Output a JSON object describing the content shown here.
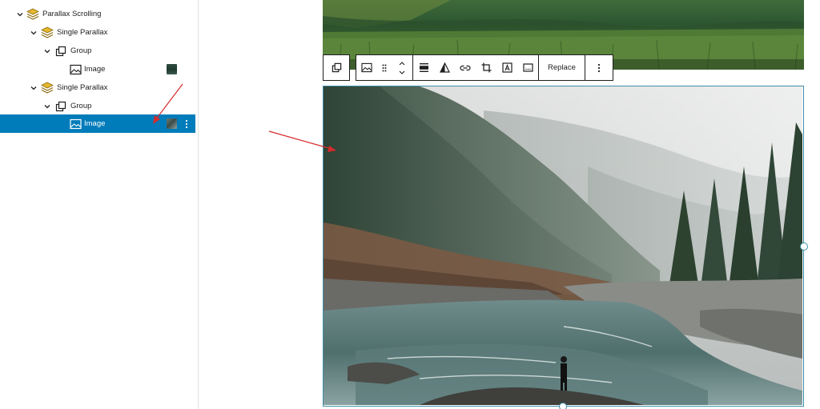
{
  "list_view": {
    "items": [
      {
        "label": "Parallax Scrolling",
        "icon": "parallax-block-icon",
        "chevron": "chevron-down-icon"
      },
      {
        "label": "Single Parallax",
        "icon": "parallax-block-icon",
        "chevron": "chevron-down-icon"
      },
      {
        "label": "Group",
        "icon": "group-icon",
        "chevron": "chevron-down-icon"
      },
      {
        "label": "Image",
        "icon": "image-icon",
        "thumbnail": "dark-forest"
      },
      {
        "label": "Single Parallax",
        "icon": "parallax-block-icon",
        "chevron": "chevron-down-icon"
      },
      {
        "label": "Group",
        "icon": "group-icon",
        "chevron": "chevron-down-icon"
      },
      {
        "label": "Image",
        "icon": "image-icon",
        "thumbnail": "river",
        "selected": true
      }
    ]
  },
  "toolbar": {
    "groups": [
      [
        "transform-icon"
      ],
      [
        "image-icon",
        "drag-handle-icon",
        "move-up-down-icon"
      ],
      [
        "align-icon",
        "duotone-icon",
        "link-icon",
        "crop-icon",
        "text-over-image-icon",
        "alt-text-icon"
      ]
    ],
    "replace_label": "Replace",
    "more_icon": "more-vertical-icon"
  },
  "colors": {
    "accent": "#007cba",
    "selection_border": "#3e8ea8",
    "annotation_arrow": "#d42b2b",
    "parallax_icon": "#e6b82e"
  }
}
